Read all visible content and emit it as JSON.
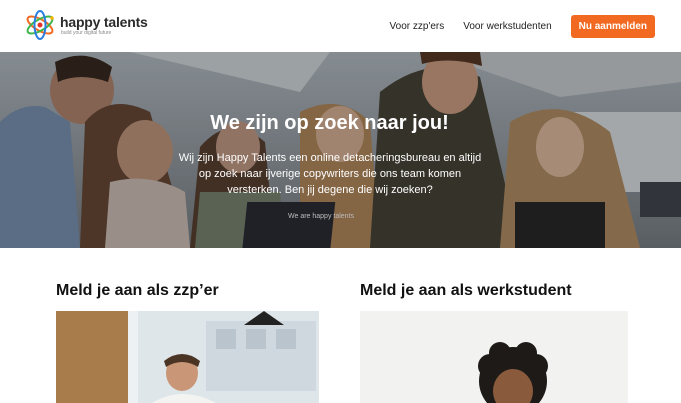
{
  "header": {
    "logo_name": "happy talents",
    "logo_tagline": "build your digital future",
    "nav": [
      {
        "label": "Voor zzp'ers"
      },
      {
        "label": "Voor werkstudenten"
      }
    ],
    "cta_label": "Nu aanmelden"
  },
  "hero": {
    "title": "We zijn op zoek naar jou!",
    "text": "Wij zijn Happy Talents een online detacheringsbureau en altijd op zoek naar ijverige copywriters die ons team komen versterken. Ben jij degene die wij zoeken?",
    "laptop_sticker": "We are happy talents"
  },
  "sections": [
    {
      "title": "Meld je aan als zzp’er"
    },
    {
      "title": "Meld je aan als werkstudent"
    }
  ],
  "colors": {
    "accent": "#f26a21",
    "text": "#1a1a1a",
    "background": "#ffffff"
  }
}
